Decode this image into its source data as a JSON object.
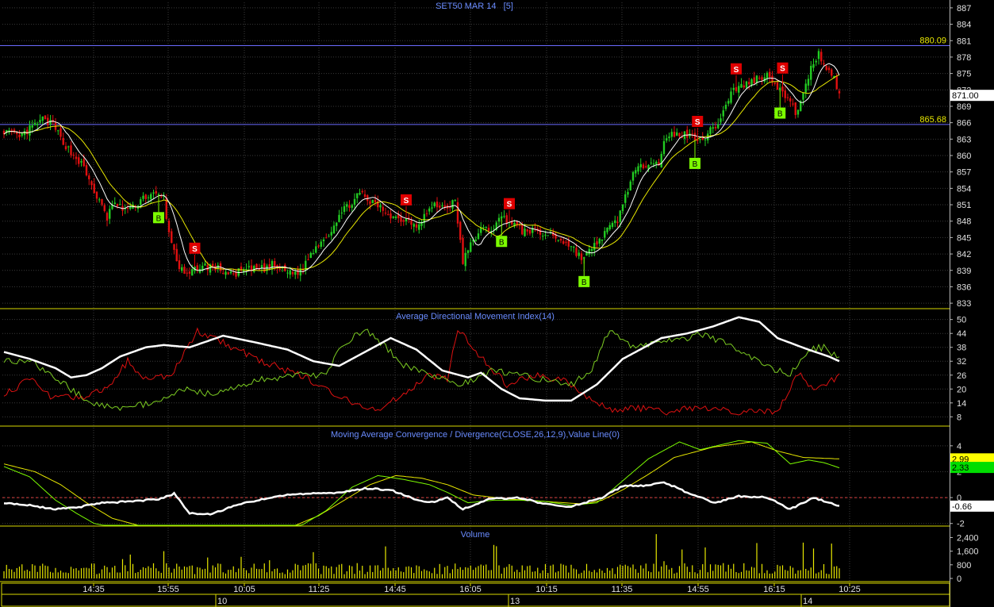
{
  "colors": {
    "background": "#000000",
    "grid": "#3a3a3a",
    "panel_border": "#d8d800",
    "title": "#6a8cff",
    "axis_text": "#e0e0e0",
    "up_candle": "#22cc22",
    "down_candle": "#e01010",
    "ma_fast": "#ffffff",
    "ma_slow": "#e8e800",
    "resistance": "#6a6aff",
    "level_label": "#e8e800",
    "signal_buy": "#7cfc00",
    "signal_sell": "#e00000",
    "adx_line": "#ffffff",
    "plus_di": "#7ccc22",
    "minus_di": "#dd1111",
    "macd_line": "#7cfc00",
    "macd_signal": "#e8e800",
    "macd_hist": "#ffffff",
    "zero_line": "#e04040",
    "volume_bar": "#e8e800",
    "price_badge_bg": "#ffffff",
    "price_badge_text": "#000000",
    "macd_badge1": "#ffff00",
    "macd_badge2": "#00dd00"
  },
  "price_panel": {
    "title": "SET50 MAR 14   [5]",
    "yticks": [
      "887",
      "884",
      "881",
      "878",
      "875",
      "872",
      "869",
      "866",
      "863",
      "860",
      "857",
      "854",
      "851",
      "848",
      "845",
      "842",
      "839",
      "836",
      "833"
    ],
    "current_price": "871.00",
    "levels": [
      {
        "value": 880.09,
        "label": "880.09"
      },
      {
        "value": 865.68,
        "label": "865.68"
      }
    ],
    "signal_buy_label": "B",
    "signal_sell_label": "S"
  },
  "adx_panel": {
    "title": "Average Directional Movement Index(14)",
    "yticks": [
      "50",
      "44",
      "38",
      "32",
      "26",
      "20",
      "14",
      "8"
    ]
  },
  "macd_panel": {
    "title": "Moving Average Convergence / Divergence(CLOSE,26,12,9),Value Line(0)",
    "yticks": [
      "4",
      "2",
      "0",
      "-2"
    ],
    "badges": [
      "2.99",
      "2.33",
      "-0.66"
    ]
  },
  "volume_panel": {
    "title": "Volume",
    "yticks": [
      "2,400",
      "1,600",
      "800",
      "0"
    ]
  },
  "x_axis": {
    "time_labels": [
      "14:35",
      "15:55",
      "10:05",
      "11:25",
      "14:45",
      "16:05",
      "10:15",
      "11:35",
      "14:55",
      "16:15",
      "10:25"
    ],
    "date_labels": [
      "10",
      "13",
      "14"
    ]
  },
  "chart_data": {
    "type": "candlestick",
    "title": "SET50 MAR 14   [5]",
    "ylim": [
      832,
      888
    ],
    "close_anchors": [
      [
        0,
        864.6
      ],
      [
        6,
        863.2
      ],
      [
        10,
        864.8
      ],
      [
        15,
        866.6
      ],
      [
        19,
        865.6
      ],
      [
        22,
        863.2
      ],
      [
        26,
        860.5
      ],
      [
        30,
        858.5
      ],
      [
        34,
        854.5
      ],
      [
        37,
        851.5
      ],
      [
        40,
        848.5
      ],
      [
        42,
        851.2
      ],
      [
        46,
        850.3
      ],
      [
        50,
        850.4
      ],
      [
        54,
        852.4
      ],
      [
        58,
        852.8
      ],
      [
        62,
        852.3
      ],
      [
        64,
        845.5
      ],
      [
        66,
        842.8
      ],
      [
        68,
        839.5
      ],
      [
        71,
        837.8
      ],
      [
        75,
        839.6
      ],
      [
        80,
        839.7
      ],
      [
        84,
        839.2
      ],
      [
        88,
        838.1
      ],
      [
        92,
        838.9
      ],
      [
        97,
        839.2
      ],
      [
        101,
        839.3
      ],
      [
        104,
        840
      ],
      [
        107,
        839.3
      ],
      [
        110,
        838.7
      ],
      [
        115,
        838.7
      ],
      [
        118,
        841.2
      ],
      [
        122,
        844
      ],
      [
        126,
        845.7
      ],
      [
        130,
        849.1
      ],
      [
        134,
        851.1
      ],
      [
        138,
        853
      ],
      [
        141,
        851.8
      ],
      [
        145,
        850.8
      ],
      [
        149,
        849.4
      ],
      [
        153,
        848.4
      ],
      [
        157,
        848.3
      ],
      [
        160,
        847.2
      ],
      [
        163,
        849.1
      ],
      [
        167,
        850.9
      ],
      [
        171,
        850.5
      ],
      [
        175,
        851.5
      ],
      [
        178,
        840.6
      ],
      [
        182,
        844.6
      ],
      [
        185,
        846.4
      ],
      [
        189,
        846.6
      ],
      [
        193,
        848.7
      ],
      [
        197,
        847.8
      ],
      [
        201,
        846.1
      ],
      [
        205,
        846.4
      ],
      [
        209,
        845.5
      ],
      [
        212,
        845.6
      ],
      [
        216,
        844.6
      ],
      [
        220,
        843.4
      ],
      [
        224,
        841.2
      ],
      [
        228,
        842.8
      ],
      [
        231,
        844.7
      ],
      [
        234,
        846.3
      ],
      [
        238,
        848.2
      ],
      [
        241,
        852.6
      ],
      [
        244,
        856.6
      ],
      [
        248,
        858.1
      ],
      [
        251,
        859.4
      ],
      [
        254,
        858.7
      ],
      [
        256,
        862.1
      ],
      [
        259,
        863.8
      ],
      [
        263,
        863.9
      ],
      [
        266,
        863.6
      ],
      [
        271,
        863.1
      ],
      [
        275,
        864.9
      ],
      [
        278,
        866.8
      ],
      [
        282,
        871.7
      ],
      [
        285,
        872.5
      ],
      [
        289,
        873.3
      ],
      [
        293,
        874.4
      ],
      [
        297,
        874.7
      ],
      [
        301,
        872
      ],
      [
        304,
        870.3
      ],
      [
        307,
        867.9
      ],
      [
        310,
        870.9
      ],
      [
        313,
        876.2
      ],
      [
        316,
        878.6
      ],
      [
        319,
        876.1
      ],
      [
        322,
        874.4
      ],
      [
        324,
        871
      ]
    ],
    "sell_signal_bars": [
      74,
      156,
      196,
      269,
      284,
      302
    ],
    "buy_signal_bars": [
      60,
      193,
      225,
      268,
      301
    ],
    "adx": {
      "ylim": [
        4,
        54
      ],
      "adx_anchors": [
        [
          0,
          36
        ],
        [
          10,
          33
        ],
        [
          20,
          29
        ],
        [
          26,
          25
        ],
        [
          32,
          26
        ],
        [
          38,
          29
        ],
        [
          45,
          34
        ],
        [
          55,
          38
        ],
        [
          62,
          39
        ],
        [
          72,
          38
        ],
        [
          85,
          43
        ],
        [
          98,
          40
        ],
        [
          110,
          37
        ],
        [
          120,
          32
        ],
        [
          130,
          30
        ],
        [
          140,
          36
        ],
        [
          150,
          42
        ],
        [
          160,
          37
        ],
        [
          170,
          28
        ],
        [
          180,
          25
        ],
        [
          185,
          27
        ],
        [
          193,
          20
        ],
        [
          200,
          16
        ],
        [
          210,
          15
        ],
        [
          220,
          15
        ],
        [
          230,
          22
        ],
        [
          240,
          33
        ],
        [
          255,
          42
        ],
        [
          265,
          44
        ],
        [
          275,
          47
        ],
        [
          285,
          51
        ],
        [
          293,
          49
        ],
        [
          300,
          42
        ],
        [
          312,
          37
        ],
        [
          320,
          34
        ],
        [
          324,
          32
        ]
      ],
      "plus_di_anchors": [
        [
          0,
          32
        ],
        [
          10,
          32
        ],
        [
          20,
          25
        ],
        [
          28,
          18
        ],
        [
          35,
          14
        ],
        [
          45,
          12
        ],
        [
          60,
          14
        ],
        [
          70,
          20
        ],
        [
          80,
          18
        ],
        [
          90,
          21
        ],
        [
          100,
          24
        ],
        [
          115,
          26
        ],
        [
          125,
          26
        ],
        [
          130,
          38
        ],
        [
          140,
          46
        ],
        [
          148,
          38
        ],
        [
          155,
          30
        ],
        [
          165,
          27
        ],
        [
          175,
          22
        ],
        [
          182,
          24
        ],
        [
          190,
          28
        ],
        [
          200,
          26
        ],
        [
          210,
          24
        ],
        [
          220,
          22
        ],
        [
          228,
          28
        ],
        [
          235,
          46
        ],
        [
          243,
          38
        ],
        [
          252,
          40
        ],
        [
          262,
          41
        ],
        [
          270,
          44
        ],
        [
          283,
          38
        ],
        [
          295,
          30
        ],
        [
          305,
          26
        ],
        [
          312,
          37
        ],
        [
          318,
          38
        ],
        [
          324,
          33
        ]
      ],
      "minus_di_anchors": [
        [
          0,
          18
        ],
        [
          10,
          24
        ],
        [
          18,
          17
        ],
        [
          30,
          16
        ],
        [
          40,
          20
        ],
        [
          48,
          32
        ],
        [
          55,
          24
        ],
        [
          65,
          26
        ],
        [
          75,
          45
        ],
        [
          85,
          40
        ],
        [
          100,
          32
        ],
        [
          115,
          26
        ],
        [
          125,
          20
        ],
        [
          135,
          14
        ],
        [
          145,
          11
        ],
        [
          155,
          18
        ],
        [
          165,
          26
        ],
        [
          172,
          24
        ],
        [
          176,
          46
        ],
        [
          185,
          34
        ],
        [
          195,
          22
        ],
        [
          205,
          26
        ],
        [
          218,
          24
        ],
        [
          228,
          15
        ],
        [
          236,
          11
        ],
        [
          245,
          12
        ],
        [
          256,
          10
        ],
        [
          265,
          12
        ],
        [
          275,
          11
        ],
        [
          288,
          10
        ],
        [
          300,
          10
        ],
        [
          308,
          27
        ],
        [
          315,
          19
        ],
        [
          324,
          26
        ]
      ]
    },
    "macd": {
      "ylim": [
        -2.2,
        5.4
      ],
      "macd_anchors": [
        [
          0,
          2.4
        ],
        [
          10,
          1.6
        ],
        [
          20,
          -0.2
        ],
        [
          28,
          -1.2
        ],
        [
          35,
          -2.0
        ],
        [
          45,
          -2.4
        ],
        [
          55,
          -2.6
        ],
        [
          65,
          -2.8
        ],
        [
          75,
          -2.9
        ],
        [
          90,
          -2.9
        ],
        [
          105,
          -2.8
        ],
        [
          115,
          -2.2
        ],
        [
          125,
          -1.0
        ],
        [
          135,
          0.8
        ],
        [
          145,
          1.7
        ],
        [
          155,
          1.4
        ],
        [
          165,
          1.0
        ],
        [
          172,
          0.4
        ],
        [
          180,
          -0.4
        ],
        [
          190,
          -0.2
        ],
        [
          200,
          -0.2
        ],
        [
          210,
          -0.3
        ],
        [
          220,
          -0.6
        ],
        [
          230,
          -0.4
        ],
        [
          240,
          1.3
        ],
        [
          250,
          3.0
        ],
        [
          262,
          4.3
        ],
        [
          270,
          3.7
        ],
        [
          285,
          4.4
        ],
        [
          296,
          4.2
        ],
        [
          305,
          2.6
        ],
        [
          312,
          2.9
        ],
        [
          318,
          2.7
        ],
        [
          324,
          2.3
        ]
      ],
      "signal_anchors": [
        [
          0,
          2.6
        ],
        [
          12,
          2.0
        ],
        [
          22,
          1.0
        ],
        [
          32,
          -0.4
        ],
        [
          42,
          -1.6
        ],
        [
          55,
          -2.3
        ],
        [
          70,
          -2.6
        ],
        [
          90,
          -2.7
        ],
        [
          110,
          -2.4
        ],
        [
          122,
          -1.4
        ],
        [
          132,
          -0.2
        ],
        [
          142,
          1.0
        ],
        [
          152,
          1.7
        ],
        [
          162,
          1.5
        ],
        [
          172,
          1.0
        ],
        [
          182,
          0.2
        ],
        [
          195,
          -0.1
        ],
        [
          210,
          -0.3
        ],
        [
          225,
          -0.5
        ],
        [
          232,
          -0.2
        ],
        [
          240,
          0.6
        ],
        [
          250,
          1.8
        ],
        [
          260,
          3.1
        ],
        [
          275,
          3.9
        ],
        [
          290,
          4.3
        ],
        [
          300,
          3.6
        ],
        [
          310,
          3.1
        ],
        [
          324,
          2.99
        ]
      ],
      "hist_anchors": [
        [
          0,
          -0.4
        ],
        [
          10,
          -0.6
        ],
        [
          20,
          -0.9
        ],
        [
          30,
          -0.7
        ],
        [
          38,
          -0.4
        ],
        [
          50,
          -0.3
        ],
        [
          60,
          -0.1
        ],
        [
          66,
          0.3
        ],
        [
          72,
          -1.2
        ],
        [
          80,
          -1.3
        ],
        [
          90,
          -0.6
        ],
        [
          100,
          -0.1
        ],
        [
          110,
          0.2
        ],
        [
          120,
          0.3
        ],
        [
          130,
          0.4
        ],
        [
          140,
          0.7
        ],
        [
          150,
          0.6
        ],
        [
          160,
          -0.2
        ],
        [
          165,
          -0.4
        ],
        [
          172,
          0.0
        ],
        [
          178,
          -0.9
        ],
        [
          188,
          -0.1
        ],
        [
          200,
          0.0
        ],
        [
          210,
          -0.5
        ],
        [
          220,
          -0.7
        ],
        [
          232,
          0.0
        ],
        [
          240,
          0.9
        ],
        [
          248,
          0.9
        ],
        [
          256,
          1.2
        ],
        [
          266,
          0.3
        ],
        [
          276,
          -0.4
        ],
        [
          285,
          0.1
        ],
        [
          296,
          0.0
        ],
        [
          305,
          -0.9
        ],
        [
          314,
          0.0
        ],
        [
          324,
          -0.66
        ]
      ]
    },
    "volume": {
      "ylim": [
        0,
        2700
      ]
    }
  }
}
